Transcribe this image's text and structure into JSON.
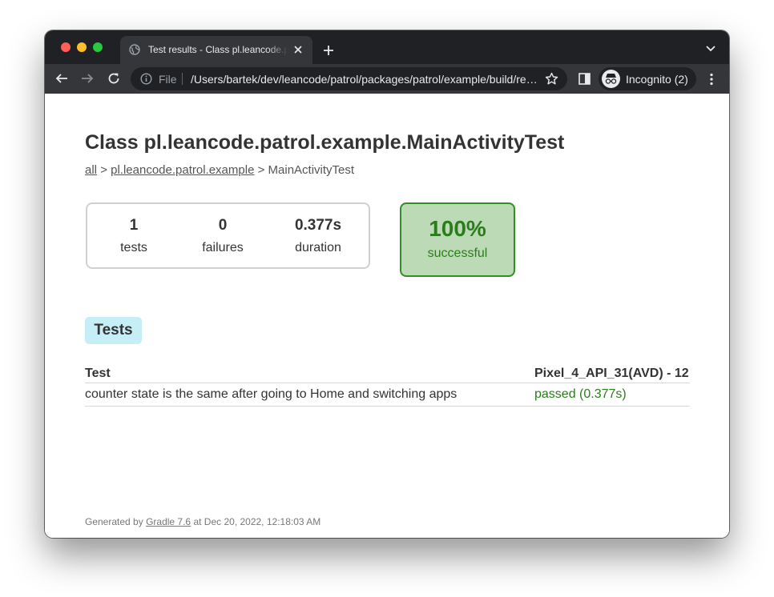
{
  "browser": {
    "tab_title": "Test results - Class pl.leancode.patrol.example.MainActivityTest",
    "file_label": "File",
    "url": "/Users/bartek/dev/leancode/patrol/packages/patrol/example/build/reports/androidTests/connected/classes/pl.leancode.patrol.example.MainActivityTest.html",
    "incognito_label": "Incognito (2)"
  },
  "page": {
    "title": "Class pl.leancode.patrol.example.MainActivityTest",
    "breadcrumb": {
      "all_link": "all",
      "separator": ">",
      "package_link": "pl.leancode.patrol.example",
      "current": "MainActivityTest"
    },
    "summary": {
      "tests_value": "1",
      "tests_label": "tests",
      "failures_value": "0",
      "failures_label": "failures",
      "duration_value": "0.377s",
      "duration_label": "duration"
    },
    "success": {
      "percent": "100%",
      "label": "successful"
    },
    "tests_tab_label": "Tests",
    "table": {
      "headers": [
        "Test",
        "Pixel_4_API_31(AVD) - 12"
      ],
      "rows": [
        {
          "test": "counter state is the same after going to Home and switching apps",
          "result": "passed (0.377s)"
        }
      ]
    },
    "footer": {
      "prefix": "Generated by",
      "gradle_link": "Gradle 7.6",
      "suffix": "at Dec 20, 2022, 12:18:03 AM"
    }
  },
  "colors": {
    "success_green": "#2b7d1c",
    "success_bg": "#bbdab5",
    "tests_tab_bg": "#c6eef6",
    "chrome_dark": "#202124"
  }
}
